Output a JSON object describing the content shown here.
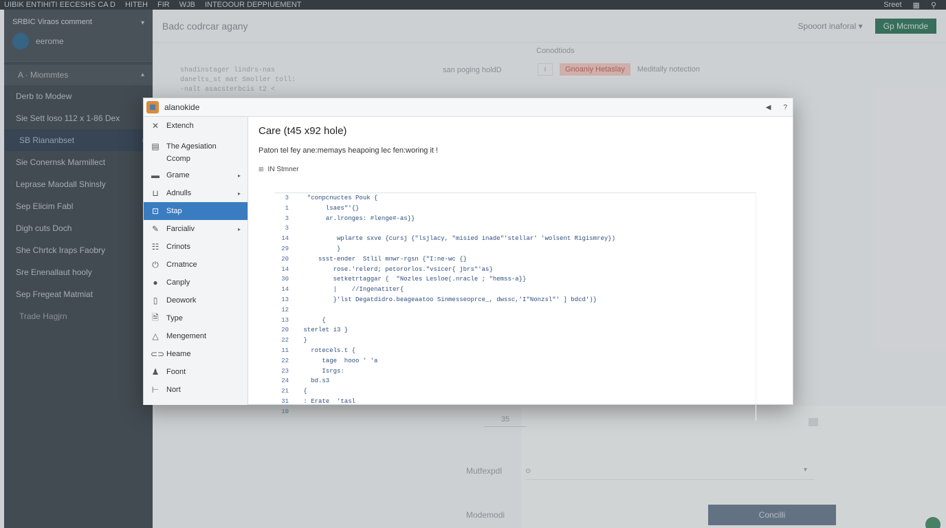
{
  "app": {
    "topbar": {
      "items": [
        "UIBIK ENTIHITI EECESHS CA D",
        "HITEH",
        "FIR",
        "WJB",
        "INTEOOUR DEPPIUEMENT"
      ],
      "right": [
        "Sreet"
      ]
    },
    "sidebar": {
      "workspace": "SRBIC Viraos comment",
      "user": "eerome",
      "group": "A · Miommtes",
      "items": [
        "Derb to Modew",
        "Sie Sett loso 112 x 1-86 Dex",
        "SB Riananbset",
        "Sie Conernsk Marmillect",
        "Leprase Maodall Shinsly",
        "Sep Elicim Fabl",
        "Digh cuts Doch",
        "She Chrtck Iraps Faobry",
        "Sre Enenallaut hooly",
        "Sep Fregeat Matmiat",
        "Trade Hagjrn"
      ]
    },
    "main": {
      "title": "Badc codrcar agany",
      "select_label": "Spooort inaforal",
      "button": "Gp Mcmnde",
      "bg_code": [
        "shadinstager lindrs-nas",
        "  danelts_st  mat  Smoller toll:",
        "  -nalt asacsterbcis t2 <"
      ],
      "mid_text": "san poging holdD",
      "conditions_label": "Conodtiods",
      "chip_i": "I",
      "chip_red": "Gnoaniy Hetaslay",
      "chip_text": "Meditally notection",
      "num_value": "35",
      "label_1": "Mutfexpdl",
      "label_2": "Modemodi",
      "submit": "Concilli"
    }
  },
  "modal": {
    "title": "alanokide",
    "nav": [
      {
        "label": "Extench",
        "icon": "wrench-icon",
        "glyph": "✕",
        "arrow": false,
        "tall": false,
        "active": false
      },
      {
        "label": "The Agesiation Ccomp",
        "icon": "document-icon",
        "glyph": "▤",
        "arrow": false,
        "tall": true,
        "active": false
      },
      {
        "label": "Grame",
        "icon": "folder-icon",
        "glyph": "▬",
        "arrow": true,
        "tall": false,
        "active": false
      },
      {
        "label": "Adnulls",
        "icon": "bracket-icon",
        "glyph": "⊔",
        "arrow": true,
        "tall": false,
        "active": false
      },
      {
        "label": "Stap",
        "icon": "screen-icon",
        "glyph": "⊡",
        "arrow": false,
        "tall": false,
        "active": true
      },
      {
        "label": "Farcialiv",
        "icon": "pencil-icon",
        "glyph": "✎",
        "arrow": true,
        "tall": false,
        "active": false
      },
      {
        "label": "Crinots",
        "icon": "list-icon",
        "glyph": "☷",
        "arrow": false,
        "tall": false,
        "active": false
      },
      {
        "label": "Crnatnce",
        "icon": "power-icon",
        "glyph": "⏻",
        "arrow": false,
        "tall": false,
        "active": false
      },
      {
        "label": "Canply",
        "icon": "circle-icon",
        "glyph": "●",
        "arrow": false,
        "tall": false,
        "active": false
      },
      {
        "label": "Deowork",
        "icon": "page-icon",
        "glyph": "▯",
        "arrow": false,
        "tall": false,
        "active": false
      },
      {
        "label": "Type",
        "icon": "file-icon",
        "glyph": "🗎",
        "arrow": false,
        "tall": false,
        "active": false
      },
      {
        "label": "Mengement",
        "icon": "triangle-icon",
        "glyph": "△",
        "arrow": false,
        "tall": false,
        "active": false
      },
      {
        "label": "Heame",
        "icon": "link-icon",
        "glyph": "⊂⊃",
        "arrow": false,
        "tall": false,
        "active": false
      },
      {
        "label": "Foont",
        "icon": "person-icon",
        "glyph": "♟",
        "arrow": false,
        "tall": false,
        "active": false
      },
      {
        "label": "Nort",
        "icon": "step-icon",
        "glyph": "⊢",
        "arrow": false,
        "tall": false,
        "active": false
      }
    ],
    "content": {
      "title": "Care (t45 x92 hole)",
      "description": "Paton tel fey ane:memays heapoing lec fen:woring it !",
      "code_label": "IN Stmner",
      "code_lines": [
        {
          "n": "3",
          "t": "  \"conpcnuctes Pouk {"
        },
        {
          "n": "1",
          "t": "       lsaes\"'{}"
        },
        {
          "n": "3",
          "t": "       ar.lronges: #lenge#-as}}"
        },
        {
          "n": "3",
          "t": ""
        },
        {
          "n": "14",
          "t": "          wplarte sxve {cursj {\"lsjlacy, \"misied inade\"'stellar' 'wolsent Rigismrey})"
        },
        {
          "n": "29",
          "t": "          }"
        },
        {
          "n": "20",
          "t": "     ssst-ender  Stlil mnwr-rgsn {\"I:ne-wc {}"
        },
        {
          "n": "14",
          "t": "         rose.'relerd; petororlos.\"vsicer{ jbrs\"'as}"
        },
        {
          "n": "30",
          "t": "         setketrtaggar {  \"Nozles Lesloe(.nracle ; \"hemss-a}}"
        },
        {
          "n": "14",
          "t": "         |    //Ingenatiter{"
        },
        {
          "n": "13",
          "t": "         }'lst Degatdidro.beageaatoo Sinmesseoprce_, dwssc,'I\"Nonzsl\"' ] bdcd')}"
        },
        {
          "n": "12",
          "t": "                                   "
        },
        {
          "n": "13",
          "t": "      {"
        },
        {
          "n": "20",
          "t": " sterlet i3 }"
        },
        {
          "n": "22",
          "t": " }"
        },
        {
          "n": "11",
          "t": "   rotecels.t {"
        },
        {
          "n": "22",
          "t": "      tage  hooo ' 'a"
        },
        {
          "n": "23",
          "t": "      Isrgs:"
        },
        {
          "n": "24",
          "t": "   bd.s3"
        },
        {
          "n": "21",
          "t": " {"
        },
        {
          "n": "31",
          "t": " : Erate  'tasl"
        },
        {
          "n": "10",
          "t": ""
        }
      ]
    }
  }
}
